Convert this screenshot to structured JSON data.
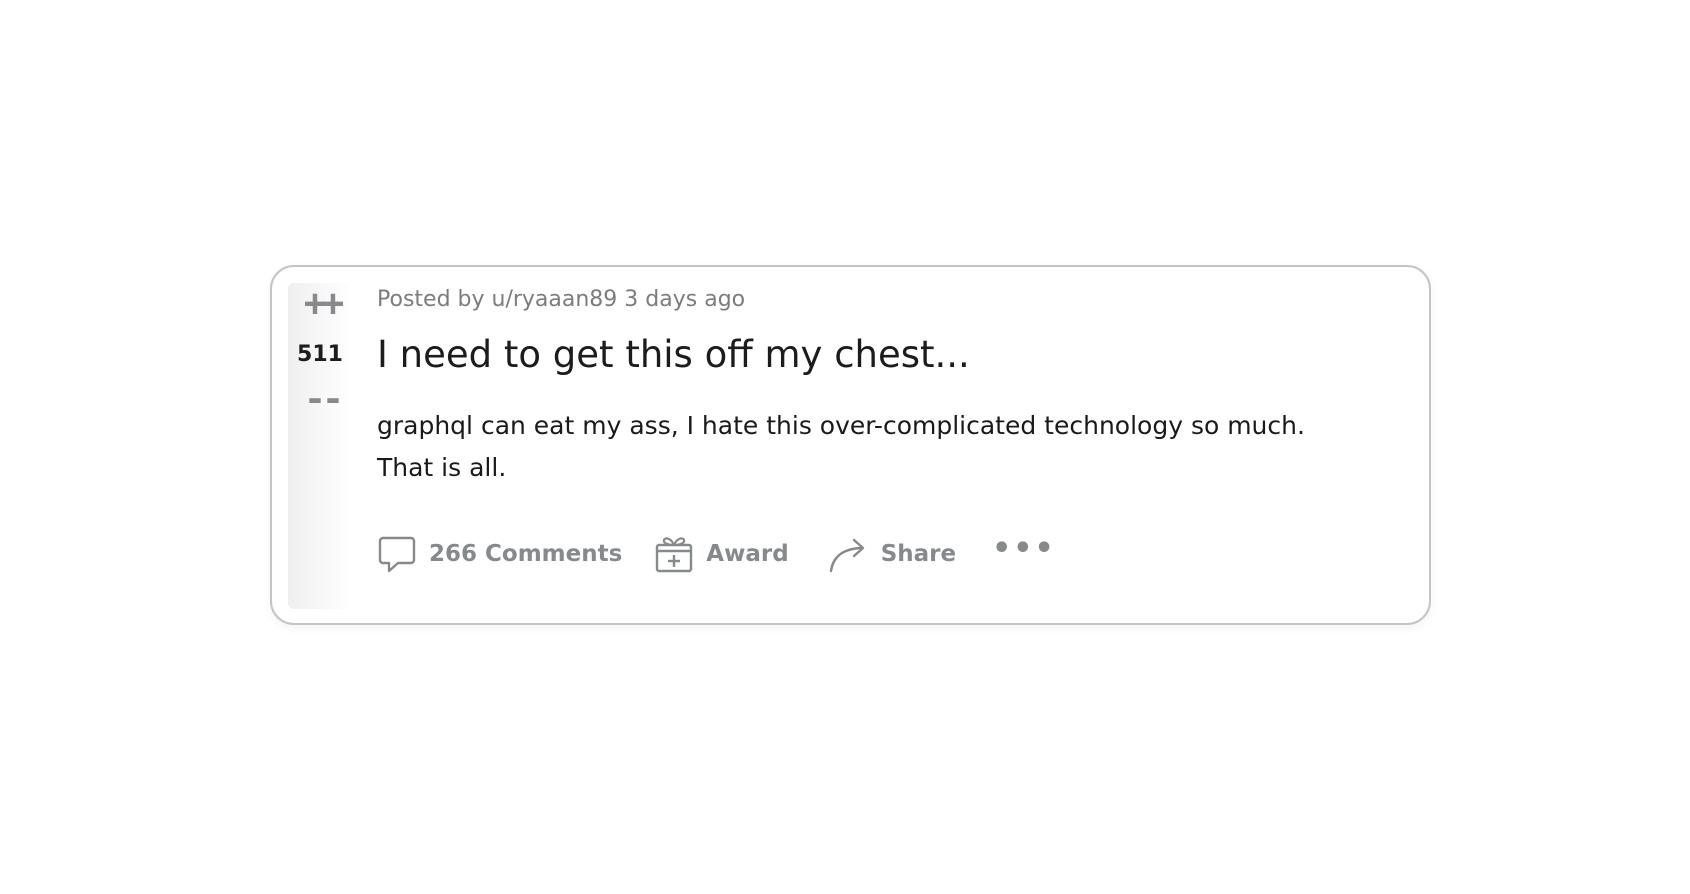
{
  "post": {
    "score": "511",
    "vote_up_glyph": "++",
    "vote_down_glyph": "--",
    "meta": "Posted by u/ryaaan89 3 days ago",
    "title": "I need to get this off my chest...",
    "body_lines": [
      "graphql can eat my ass, I hate this over-complicated technology so much.",
      "That is all."
    ],
    "actions": {
      "comments_label": "266 Comments",
      "award_label": "Award",
      "share_label": "Share",
      "more_label": "•••"
    },
    "icons": {
      "comments": "comment-bubble-icon",
      "award": "gift-icon",
      "share": "share-arrow-icon"
    },
    "colors": {
      "text_primary": "#1c1c1c",
      "text_muted": "#7c7c7c",
      "icon_gray": "#878a8c",
      "card_border": "#c4c4c4"
    }
  }
}
